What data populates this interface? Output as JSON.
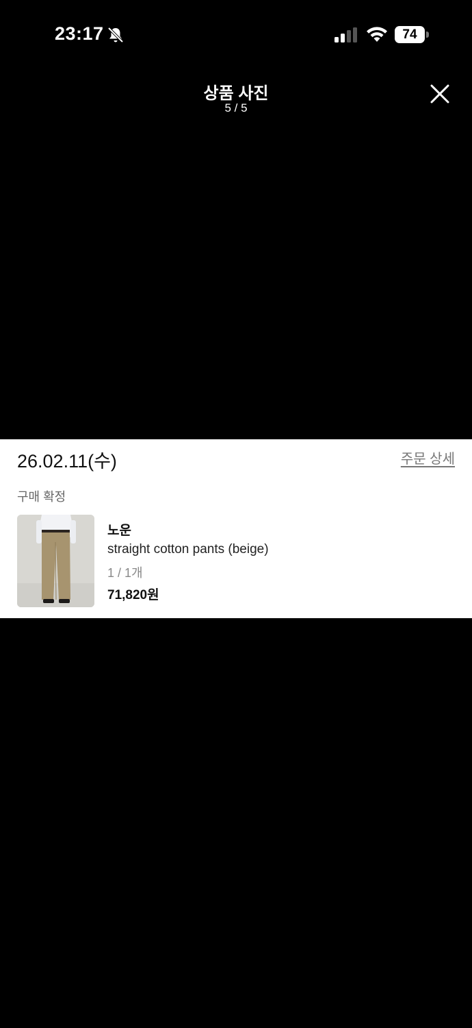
{
  "status_bar": {
    "time": "23:17",
    "battery_level": "74",
    "icons": [
      "bell-slash-icon",
      "cellular-signal-icon",
      "wifi-icon",
      "battery-icon"
    ]
  },
  "viewer": {
    "title": "상품 사진",
    "counter": "5 / 5",
    "close_icon": "close-icon"
  },
  "order": {
    "date": "26.02.11(수)",
    "detail_link": "주문 상세",
    "status": "구매 확정",
    "product": {
      "brand": "노운",
      "name": "straight cotton pants (beige)",
      "quantity": "1 / 1개",
      "price": "71,820원"
    }
  },
  "colors": {
    "background": "#000000",
    "card": "#ffffff",
    "muted_text": "#777777"
  }
}
